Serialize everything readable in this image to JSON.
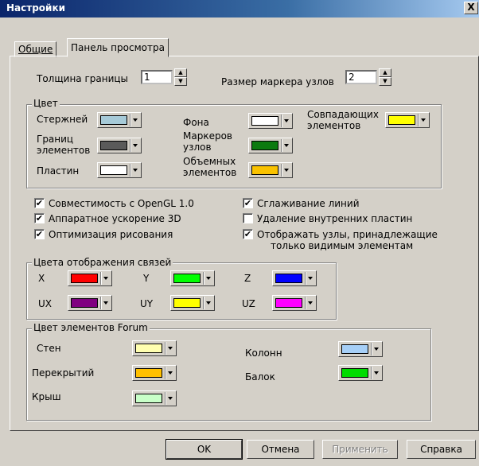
{
  "window": {
    "title": "Настройки",
    "close": "X"
  },
  "tabs": [
    {
      "label": "Общие"
    },
    {
      "label": "Панель просмотра"
    }
  ],
  "border": {
    "thickness_label": "Толщина границы",
    "thickness_value": "1",
    "marker_label": "Размер маркера узлов",
    "marker_value": "2"
  },
  "color_group": {
    "title": "Цвет",
    "items": [
      {
        "label": "Стержней",
        "color": "#a6cad8"
      },
      {
        "label": "Границ элементов",
        "color": "#5a5a5a"
      },
      {
        "label": "Пластин",
        "color": "#ffffff"
      },
      {
        "label": "Фона",
        "color": "#ffffff"
      },
      {
        "label": "Маркеров узлов",
        "color": "#0c7a10"
      },
      {
        "label": "Объемных элементов",
        "color": "#f9c200"
      },
      {
        "label": "Совпадающих элементов",
        "color": "#ffff00"
      }
    ]
  },
  "checks": [
    {
      "label": "Совместимость с OpenGL 1.0",
      "checked": true
    },
    {
      "label": "Аппаратное ускорение 3D",
      "checked": true
    },
    {
      "label": "Оптимизация рисования",
      "checked": true
    },
    {
      "label": "Сглаживание линий",
      "checked": true
    },
    {
      "label": "Удаление внутренних пластин",
      "checked": false
    },
    {
      "label": "Отображать узлы, принадлежащие",
      "label2": "только видимым элементам",
      "checked": true
    }
  ],
  "links_group": {
    "title": "Цвета отображения связей",
    "items": [
      {
        "label": "X",
        "color": "#ff0000"
      },
      {
        "label": "Y",
        "color": "#00ff00"
      },
      {
        "label": "Z",
        "color": "#0000ff"
      },
      {
        "label": "UX",
        "color": "#800080"
      },
      {
        "label": "UY",
        "color": "#ffff00"
      },
      {
        "label": "UZ",
        "color": "#ff00ff"
      }
    ]
  },
  "forum_group": {
    "title": "Цвет элементов Forum",
    "items": [
      {
        "label": "Стен",
        "color": "#ffffb0"
      },
      {
        "label": "Перекрытий",
        "color": "#ffc000"
      },
      {
        "label": "Крыш",
        "color": "#c8ffc8"
      },
      {
        "label": "Колонн",
        "color": "#a6cff7"
      },
      {
        "label": "Балок",
        "color": "#00dc00"
      }
    ]
  },
  "buttons": {
    "ok": "OK",
    "cancel": "Отмена",
    "apply": "Применить",
    "help": "Справка"
  }
}
